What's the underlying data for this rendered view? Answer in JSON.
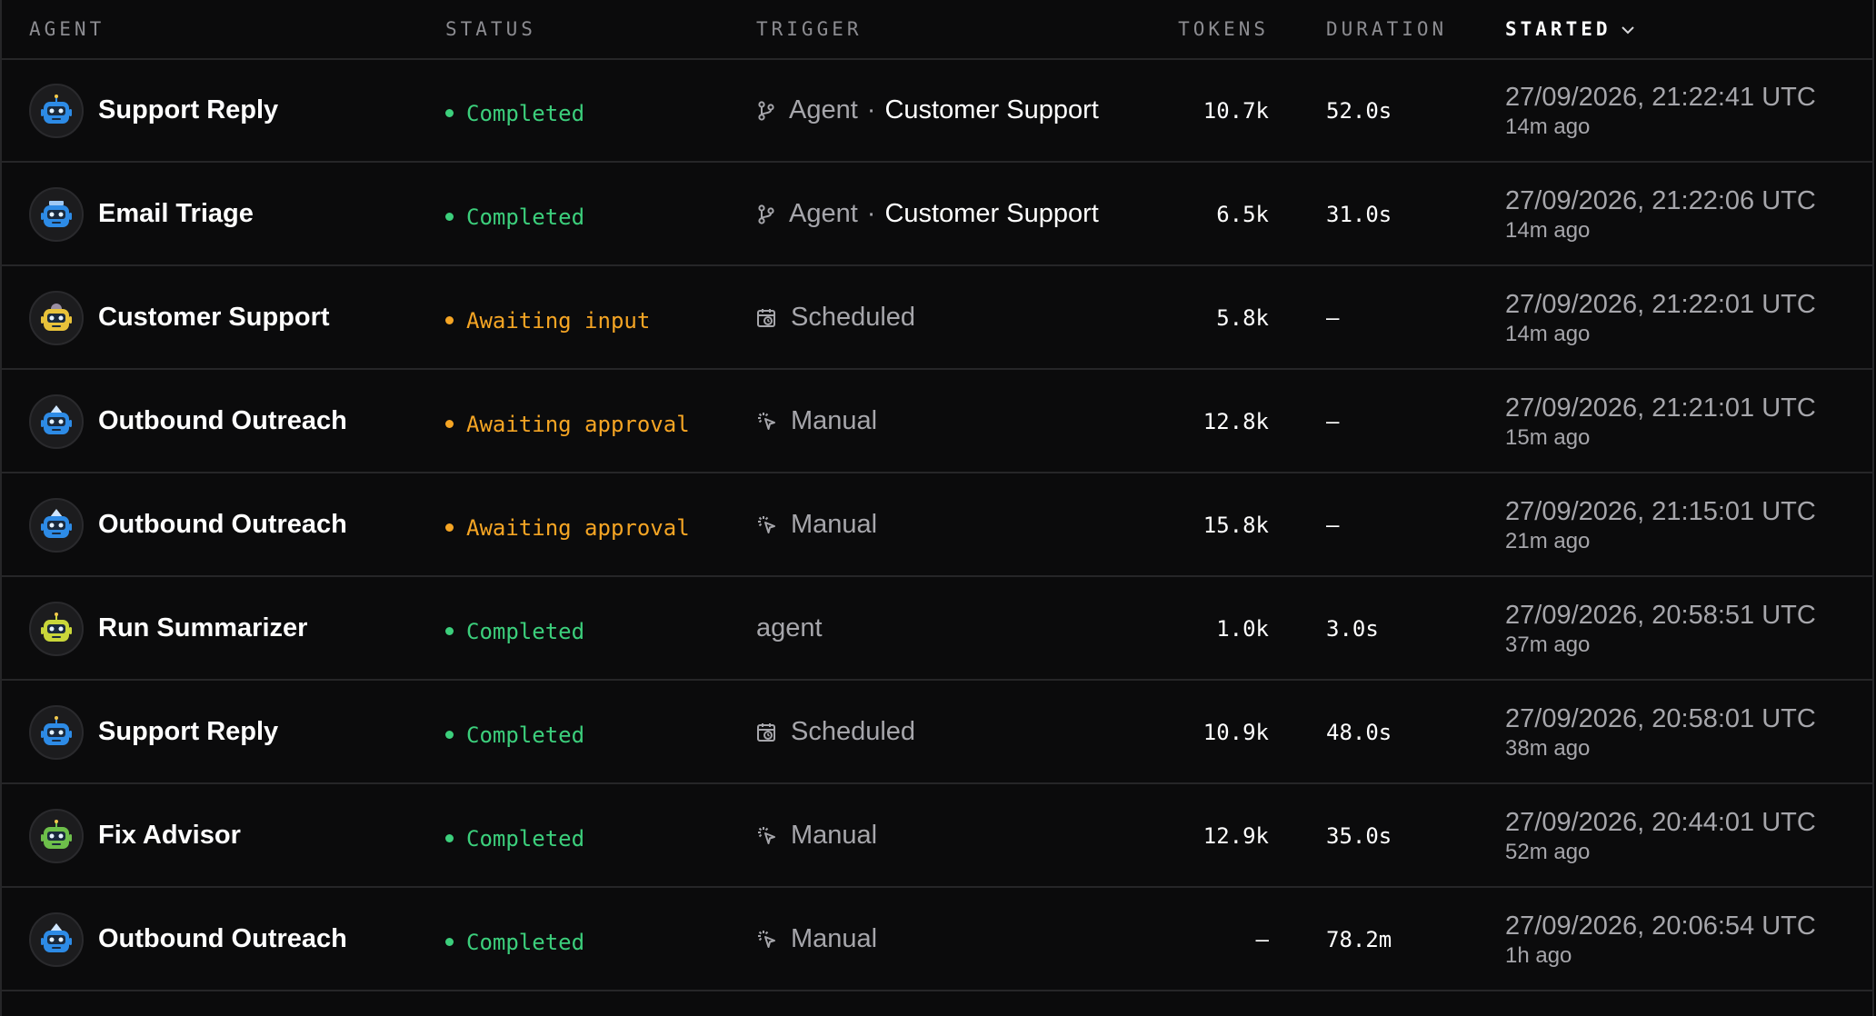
{
  "headers": {
    "agent": "AGENT",
    "status": "STATUS",
    "trigger": "TRIGGER",
    "tokens": "TOKENS",
    "duration": "DURATION",
    "started": "STARTED"
  },
  "sort": {
    "column": "started",
    "icon": "chevron-down-icon"
  },
  "colors": {
    "completed": "#3ccf7c",
    "awaiting": "#f5a524",
    "robot_blue": "#2d8be6",
    "robot_yellow": "#e8c23a",
    "robot_lime": "#c9d63a",
    "robot_green": "#6dbf4a"
  },
  "runs": [
    {
      "agent": "Support Reply",
      "avatar": "robot-blue-antenna",
      "status": "Completed",
      "status_kind": "completed",
      "trigger_icon": "agent-branch-icon",
      "trigger": "Agent",
      "trigger_sep": "·",
      "trigger_target": "Customer Support",
      "tokens": "10.7k",
      "duration": "52.0s",
      "started": "27/09/2026, 21:22:41 UTC",
      "ago": "14m ago"
    },
    {
      "agent": "Email Triage",
      "avatar": "robot-blue-crown",
      "status": "Completed",
      "status_kind": "completed",
      "trigger_icon": "agent-branch-icon",
      "trigger": "Agent",
      "trigger_sep": "·",
      "trigger_target": "Customer Support",
      "tokens": "6.5k",
      "duration": "31.0s",
      "started": "27/09/2026, 21:22:06 UTC",
      "ago": "14m ago"
    },
    {
      "agent": "Customer Support",
      "avatar": "robot-yellow-dome",
      "status": "Awaiting input",
      "status_kind": "awaiting",
      "trigger_icon": "calendar-clock-icon",
      "trigger": "Scheduled",
      "trigger_sep": "",
      "trigger_target": "",
      "tokens": "5.8k",
      "duration": "—",
      "started": "27/09/2026, 21:22:01 UTC",
      "ago": "14m ago"
    },
    {
      "agent": "Outbound Outreach",
      "avatar": "robot-blue-cone",
      "status": "Awaiting approval",
      "status_kind": "awaiting",
      "trigger_icon": "click-pointer-icon",
      "trigger": "Manual",
      "trigger_sep": "",
      "trigger_target": "",
      "tokens": "12.8k",
      "duration": "—",
      "started": "27/09/2026, 21:21:01 UTC",
      "ago": "15m ago"
    },
    {
      "agent": "Outbound Outreach",
      "avatar": "robot-blue-cone",
      "status": "Awaiting approval",
      "status_kind": "awaiting",
      "trigger_icon": "click-pointer-icon",
      "trigger": "Manual",
      "trigger_sep": "",
      "trigger_target": "",
      "tokens": "15.8k",
      "duration": "—",
      "started": "27/09/2026, 21:15:01 UTC",
      "ago": "21m ago"
    },
    {
      "agent": "Run Summarizer",
      "avatar": "robot-lime-antenna",
      "status": "Completed",
      "status_kind": "completed",
      "trigger_icon": "",
      "trigger": "agent",
      "trigger_sep": "",
      "trigger_target": "",
      "tokens": "1.0k",
      "duration": "3.0s",
      "started": "27/09/2026, 20:58:51 UTC",
      "ago": "37m ago"
    },
    {
      "agent": "Support Reply",
      "avatar": "robot-blue-antenna",
      "status": "Completed",
      "status_kind": "completed",
      "trigger_icon": "calendar-clock-icon",
      "trigger": "Scheduled",
      "trigger_sep": "",
      "trigger_target": "",
      "tokens": "10.9k",
      "duration": "48.0s",
      "started": "27/09/2026, 20:58:01 UTC",
      "ago": "38m ago"
    },
    {
      "agent": "Fix Advisor",
      "avatar": "robot-green-antenna",
      "status": "Completed",
      "status_kind": "completed",
      "trigger_icon": "click-pointer-icon",
      "trigger": "Manual",
      "trigger_sep": "",
      "trigger_target": "",
      "tokens": "12.9k",
      "duration": "35.0s",
      "started": "27/09/2026, 20:44:01 UTC",
      "ago": "52m ago"
    },
    {
      "agent": "Outbound Outreach",
      "avatar": "robot-blue-cone",
      "status": "Completed",
      "status_kind": "completed",
      "trigger_icon": "click-pointer-icon",
      "trigger": "Manual",
      "trigger_sep": "",
      "trigger_target": "",
      "tokens": "—",
      "duration": "78.2m",
      "started": "27/09/2026, 20:06:54 UTC",
      "ago": "1h ago"
    }
  ]
}
